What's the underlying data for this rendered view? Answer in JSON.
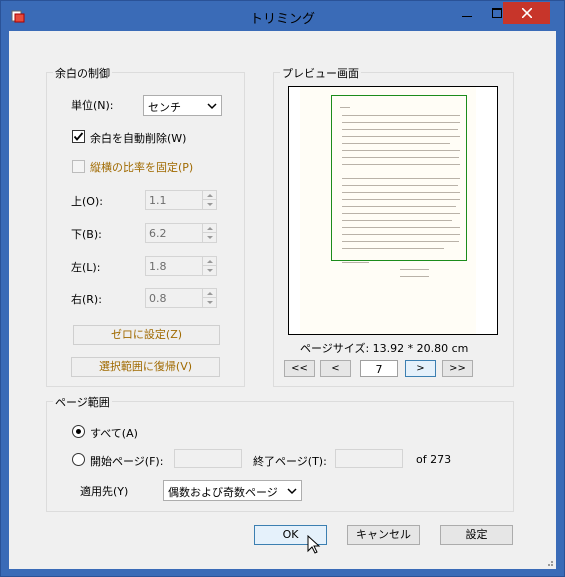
{
  "window": {
    "title": "トリミング"
  },
  "margin_group": {
    "title": "余白の制御",
    "unit_label": "単位(N):",
    "unit_value": "センチ",
    "auto_trim_label": "余白を自動削除(W)",
    "auto_trim_checked": true,
    "keep_ratio_label": "縦横の比率を固定(P)",
    "keep_ratio_checked": false,
    "top_label": "上(O):",
    "top_value": "1.1",
    "bottom_label": "下(B):",
    "bottom_value": "6.2",
    "left_label": "左(L):",
    "left_value": "1.8",
    "right_label": "右(R):",
    "right_value": "0.8",
    "zero_button": "ゼロに設定(Z)",
    "restore_button": "選択範囲に復帰(V)"
  },
  "preview_group": {
    "title": "プレビュー画面",
    "page_size_text": "ページサイズ: 13.92  *  20.80 cm",
    "current_page": "7",
    "first_label": "<<",
    "prev_label": "<",
    "next_label": ">",
    "last_label": ">>"
  },
  "page_range_group": {
    "title": "ページ範囲",
    "all_label": "すべて(A)",
    "all_checked": true,
    "start_label": "開始ページ(F):",
    "start_value": "",
    "end_label": "終了ページ(T):",
    "end_value": "",
    "of_text": "of 273",
    "apply_label": "適用先(Y)",
    "apply_value": "偶数および奇数ページ"
  },
  "buttons": {
    "ok": "OK",
    "cancel": "キャンセル",
    "settings": "設定"
  },
  "colors": {
    "titlebar": "#3a6bb7",
    "close": "#c7352a",
    "margin_box": "#1b8c1b",
    "disabled_text": "#a06a00"
  },
  "icons": [
    "app-icon",
    "minimize-icon",
    "maximize-icon",
    "close-icon",
    "chevron-down-icon",
    "checkmark-icon",
    "mouse-cursor-icon"
  ]
}
